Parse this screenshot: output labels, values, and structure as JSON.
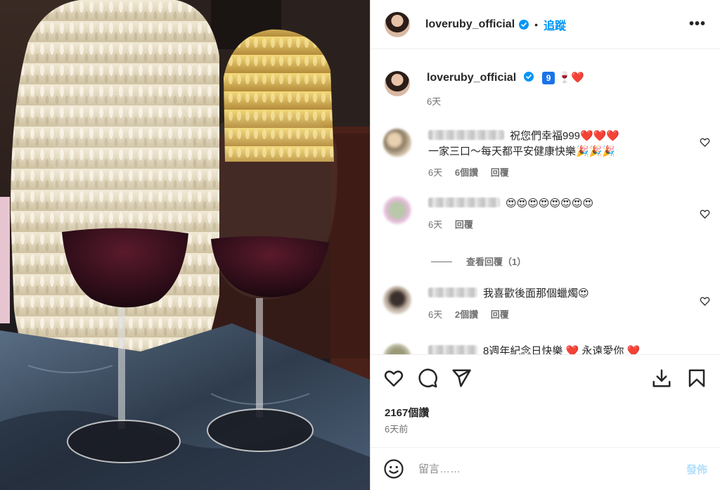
{
  "header": {
    "username": "loveruby_official",
    "separator": "•",
    "follow_label": "追蹤",
    "more_label": "•••"
  },
  "caption": {
    "username": "loveruby_official",
    "badge": "9",
    "emoji": "🍷❤️",
    "time": "6天"
  },
  "comments": [
    {
      "text_line1": "祝您們幸福999❤️❤️❤️",
      "text_line2": "一家三口～每天都平安健康快樂🎉🎉🎉",
      "time": "6天",
      "likes": "6個讚",
      "reply_label": "回覆"
    },
    {
      "text_line1": "😍😍😍😍😍😍😍😍",
      "time": "6天",
      "reply_label": "回覆",
      "view_replies": "查看回覆（1）"
    },
    {
      "text_line1": "我喜歡後面那個蠟燭😍",
      "time": "6天",
      "likes": "2個讚",
      "reply_label": "回覆"
    },
    {
      "text_line1": "8週年紀念日快樂 ❤️ 永遠愛你 ❤️"
    }
  ],
  "post": {
    "likes": "2167個讚",
    "time_ago": "6天前"
  },
  "composer": {
    "placeholder": "留言……",
    "post_label": "發佈"
  },
  "colors": {
    "accent": "#0095f6",
    "post_disabled": "#b2dffc",
    "secondary_text": "#737373",
    "wine": "#3a0b1c"
  },
  "icons": [
    "verified-icon",
    "more-icon",
    "heart-icon",
    "comment-icon",
    "share-icon",
    "save-icon",
    "bookmark-icon",
    "emoji-icon"
  ]
}
